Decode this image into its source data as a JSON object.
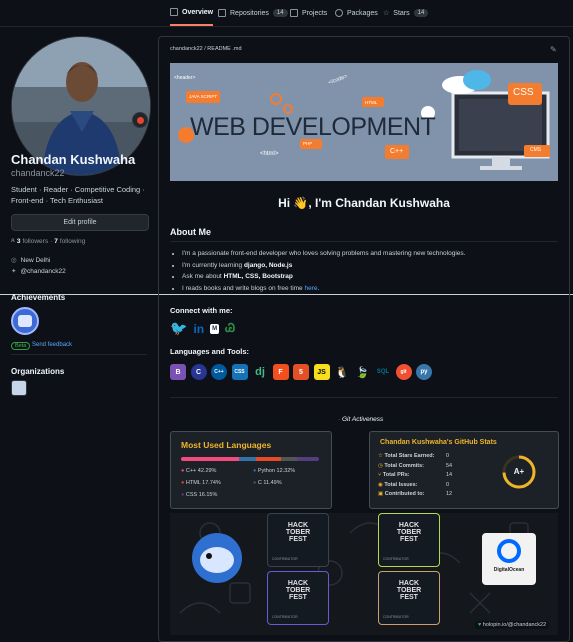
{
  "nav": {
    "overview": "Overview",
    "repositories": "Repositories",
    "repositories_count": "14",
    "projects": "Projects",
    "packages": "Packages",
    "stars": "Stars",
    "stars_count": "14"
  },
  "profile": {
    "name": "Chandan Kushwaha",
    "username": "chandanck22",
    "bio_line1": "Student · Reader · Competitive Coding ·",
    "bio_line2": "Front-end · Tech Enthusiast",
    "edit_button": "Edit profile",
    "followers_count": "3",
    "followers_label": "followers",
    "following_count": "7",
    "following_label": "following",
    "location": "New Delhi",
    "twitter": "@chandanck22"
  },
  "achievements": {
    "title": "Achievements",
    "beta": "Beta",
    "feedback": "Send feedback"
  },
  "organizations": {
    "title": "Organizations"
  },
  "readme": {
    "path": "chandanck22 / README .md",
    "banner_title": "WEB DEVELOPMENT",
    "banner_tags": [
      "<header>",
      "JAVA SCRIPT",
      "</code>",
      "HTML",
      "CSS",
      "PHP",
      "<html>",
      "C++",
      "CMS"
    ],
    "hi": "Hi 👋, I'm Chandan Kushwaha",
    "about_title": "About Me",
    "bullets": [
      {
        "pre": "I'm a passionate front-end developer who loves solving problems and mastering new technologies.",
        "bold": "",
        "post": ""
      },
      {
        "pre": "I'm currently learning ",
        "bold": "django, Node.js",
        "post": ""
      },
      {
        "pre": "Ask me about ",
        "bold": "HTML, CSS, Bootstrap",
        "post": ""
      },
      {
        "pre": "I reads books and write blogs on free time ",
        "bold": "",
        "post": "",
        "link": "here",
        "end": "."
      }
    ],
    "connect_title": "Connect with me:",
    "tools_title": "Languages and Tools:",
    "tools": [
      "B",
      "C",
      "C++",
      "CSS",
      "dj",
      "F",
      "5",
      "JS",
      "🐧",
      "🍃",
      "SQL",
      "git",
      "py"
    ],
    "git_activeness": "Git Activeness"
  },
  "languages_card": {
    "title": "Most Used Languages",
    "items": [
      {
        "name": "C++",
        "pct": "42.29%",
        "color": "#f34b7d",
        "value": 42.29
      },
      {
        "name": "Python",
        "pct": "12.32%",
        "color": "#3572a5",
        "value": 12.32
      },
      {
        "name": "HTML",
        "pct": "17.74%",
        "color": "#e34c26",
        "value": 17.74
      },
      {
        "name": "C",
        "pct": "11.49%",
        "color": "#555555",
        "value": 11.49
      },
      {
        "name": "CSS",
        "pct": "16.15%",
        "color": "#563d7c",
        "value": 16.15
      }
    ]
  },
  "stats_card": {
    "title": "Chandan Kushwaha's GitHub Stats",
    "rows": [
      {
        "label": "Total Stars Earned:",
        "value": "0"
      },
      {
        "label": "Total Commits:",
        "value": "54"
      },
      {
        "label": "Total PRs:",
        "value": "14"
      },
      {
        "label": "Total Issues:",
        "value": "0"
      },
      {
        "label": "Contributed to:",
        "value": "12"
      }
    ],
    "grade": "A+"
  },
  "badges": {
    "hack_line1": "HACK",
    "hack_line2": "TOBER",
    "hack_line3": "FEST",
    "contributor": "CONTRIBUTOR",
    "digitalocean": "DigitalOcean",
    "holopin": "holopin.io/@chandanck22"
  },
  "colors": {
    "accent": "#f78166",
    "link": "#58a6ff",
    "bg": "#0d1117"
  }
}
